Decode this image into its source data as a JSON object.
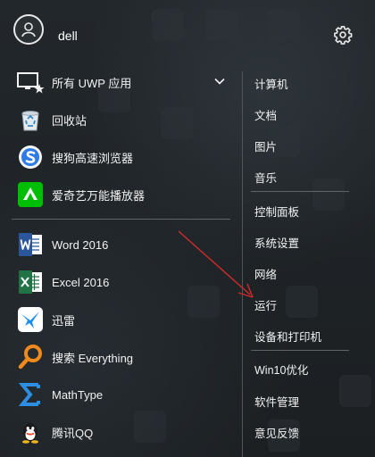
{
  "user": {
    "name": "dell"
  },
  "apps": [
    {
      "name": "all-apps",
      "label": "所有 UWP 应用",
      "icon": "all-apps-icon"
    },
    {
      "name": "recycle-bin",
      "label": "回收站",
      "icon": "recycle-bin-icon"
    },
    {
      "name": "sogou-browser",
      "label": "搜狗高速浏览器",
      "icon": "sogou-browser-icon"
    },
    {
      "name": "iqiyi-player",
      "label": "爱奇艺万能播放器",
      "icon": "iqiyi-icon"
    },
    {
      "name": "word-2016",
      "label": "Word 2016",
      "icon": "word-icon"
    },
    {
      "name": "excel-2016",
      "label": "Excel 2016",
      "icon": "excel-icon"
    },
    {
      "name": "xunlei",
      "label": "迅雷",
      "icon": "xunlei-icon"
    },
    {
      "name": "everything",
      "label": "搜索 Everything",
      "icon": "everything-icon"
    },
    {
      "name": "mathtype",
      "label": "MathType",
      "icon": "mathtype-icon"
    },
    {
      "name": "qq",
      "label": "腾讯QQ",
      "icon": "qq-icon"
    }
  ],
  "links": [
    {
      "name": "computer",
      "label": "计算机"
    },
    {
      "name": "documents",
      "label": "文档"
    },
    {
      "name": "pictures",
      "label": "图片"
    },
    {
      "name": "music",
      "label": "音乐"
    },
    {
      "name": "control-panel",
      "label": "控制面板"
    },
    {
      "name": "system-settings",
      "label": "系统设置"
    },
    {
      "name": "network",
      "label": "网络"
    },
    {
      "name": "run",
      "label": "运行"
    },
    {
      "name": "devices-printers",
      "label": "设备和打印机"
    },
    {
      "name": "win10-optimize",
      "label": "Win10优化"
    },
    {
      "name": "software-manager",
      "label": "软件管理"
    },
    {
      "name": "feedback",
      "label": "意见反馈"
    }
  ],
  "colors": {
    "word": "#2b579a",
    "excel": "#217346",
    "iqiyi": "#00be06",
    "arrow": "#d42a2a"
  }
}
